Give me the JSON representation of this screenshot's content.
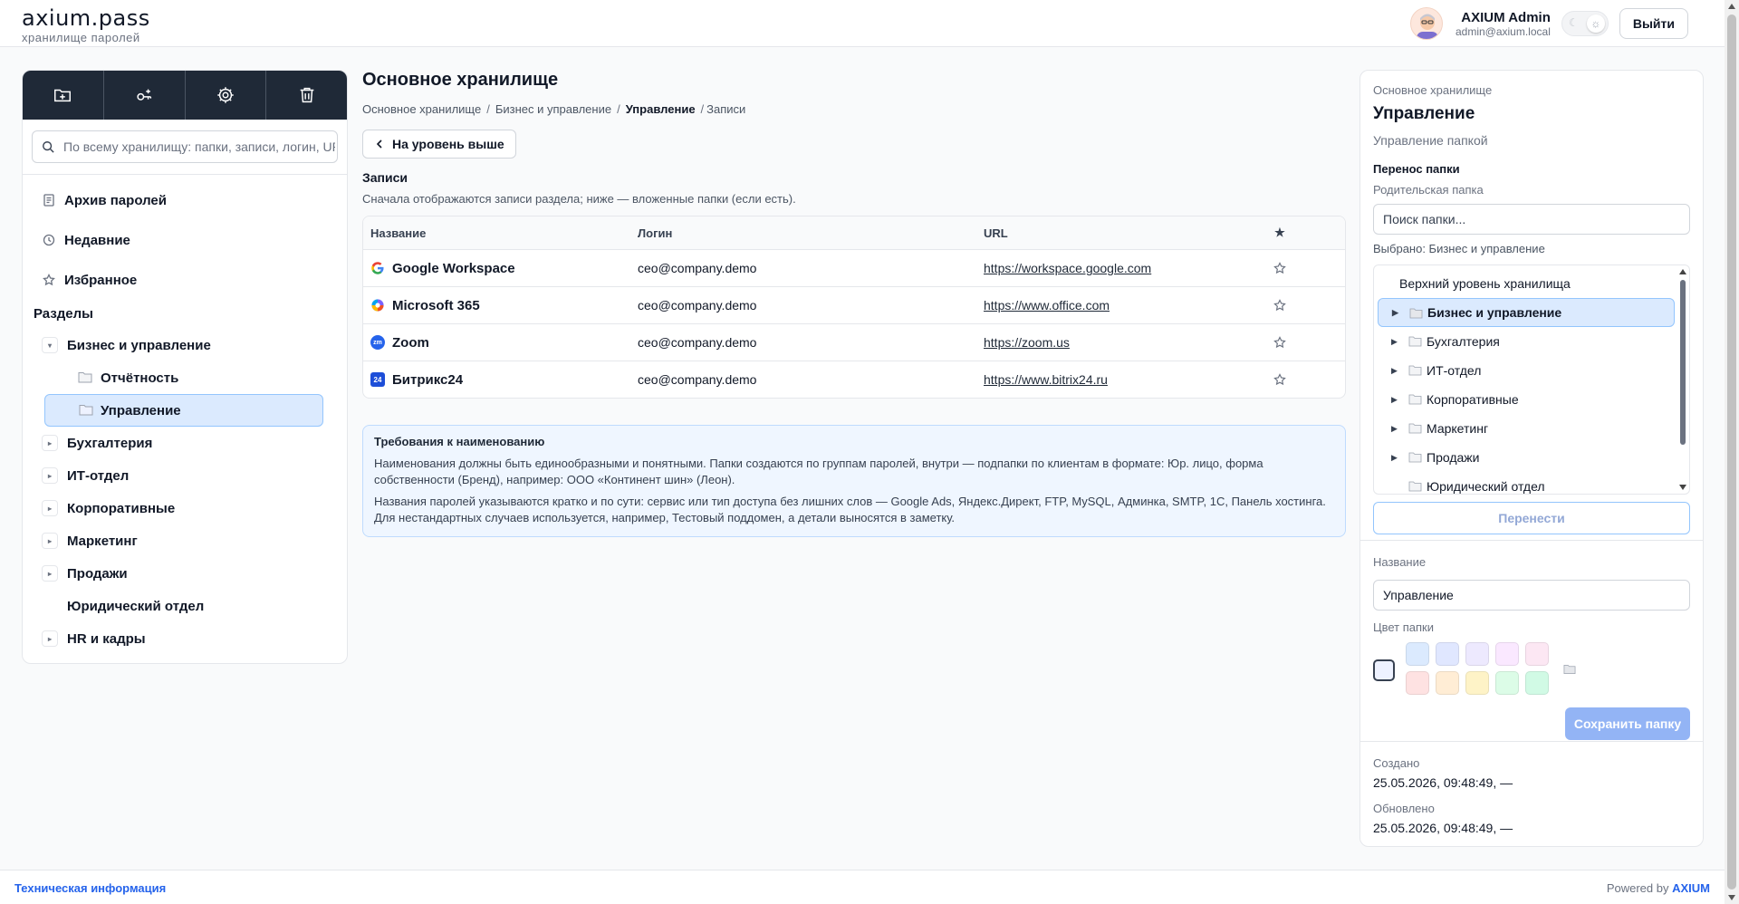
{
  "app": {
    "name": "axium.pass",
    "subtitle": "хранилище паролей"
  },
  "user": {
    "name": "AXIUM Admin",
    "email": "admin@axium.local",
    "logout_label": "Выйти"
  },
  "sidebar": {
    "search_placeholder": "По всему хранилищу: папки, записи, логин, URL",
    "nav": [
      {
        "label": "Архив паролей",
        "icon": "archive-icon"
      },
      {
        "label": "Недавние",
        "icon": "clock-icon"
      },
      {
        "label": "Избранное",
        "icon": "star-icon"
      }
    ],
    "sections_title": "Разделы",
    "tree": [
      {
        "label": "Бизнес и управление"
      },
      {
        "label": "Отчётность"
      },
      {
        "label": "Управление"
      },
      {
        "label": "Бухгалтерия"
      },
      {
        "label": "ИТ-отдел"
      },
      {
        "label": "Корпоративные"
      },
      {
        "label": "Маркетинг"
      },
      {
        "label": "Продажи"
      },
      {
        "label": "Юридический отдел"
      },
      {
        "label": "HR и кадры"
      }
    ]
  },
  "main": {
    "title": "Основное хранилище",
    "breadcrumb": [
      "Основное хранилище",
      "Бизнес и управление",
      "Управление",
      "Записи"
    ],
    "up_button": "На уровень выше",
    "records_title": "Записи",
    "records_sub": "Сначала отображаются записи раздела; ниже — вложенные папки (если есть).",
    "columns": [
      "Название",
      "Логин",
      "URL",
      "★"
    ],
    "rows": [
      {
        "name": "Google Workspace",
        "login": "ceo@company.demo",
        "url": "https://workspace.google.com",
        "icon": "google-icon"
      },
      {
        "name": "Microsoft 365",
        "login": "ceo@company.demo",
        "url": "https://www.office.com",
        "icon": "microsoft365-icon"
      },
      {
        "name": "Zoom",
        "login": "ceo@company.demo",
        "url": "https://zoom.us",
        "icon": "zoom-icon",
        "icon_text": "zm"
      },
      {
        "name": "Битрикс24",
        "login": "ceo@company.demo",
        "url": "https://www.bitrix24.ru",
        "icon": "bitrix24-icon",
        "icon_text": "24"
      }
    ],
    "notice": {
      "title": "Требования к наименованию",
      "p1": "Наименования должны быть единообразными и понятными. Папки создаются по группам паролей, внутри — подпапки по клиентам в формате: Юр. лицо, форма собственности (Бренд), например: ООО «Континент шин» (Леон).",
      "p2": "Названия паролей указываются кратко и по сути: сервис или тип доступа без лишних слов — Google Ads, Яндекс.Директ, FTP, MySQL, Админка, SMTP, 1С, Панель хостинга. Для нестандартных случаев используется, например, Тестовый поддомен, а детали выносятся в заметку."
    }
  },
  "panel": {
    "crumb": "Основное хранилище",
    "title": "Управление",
    "subtitle": "Управление папкой",
    "move_title": "Перенос папки",
    "parent_label": "Родительская папка",
    "parent_search_placeholder": "Поиск папки...",
    "selected_text": "Выбрано: Бизнес и управление",
    "folder_tree": [
      "Верхний уровень хранилища",
      "Бизнес и управление",
      "Бухгалтерия",
      "ИТ-отдел",
      "Корпоративные",
      "Маркетинг",
      "Продажи",
      "Юридический отдел"
    ],
    "move_button": "Перенести",
    "name_label": "Название",
    "name_value": "Управление",
    "color_label": "Цвет папки",
    "colors": [
      "#dbeafe",
      "#e0e7ff",
      "#ede9fe",
      "#fae8ff",
      "#fce7f3",
      "#fee2e2",
      "#ffedd5",
      "#fef3c7",
      "#dcfce7",
      "#d1fae5"
    ],
    "save_button": "Сохранить папку",
    "created_label": "Создано",
    "created_value": "25.05.2026, 09:48:49, —",
    "updated_label": "Обновлено",
    "updated_value": "25.05.2026, 09:48:49, —"
  },
  "footer": {
    "tech_link": "Техническая информация",
    "powered": "Powered by",
    "brand": "AXIUM"
  }
}
